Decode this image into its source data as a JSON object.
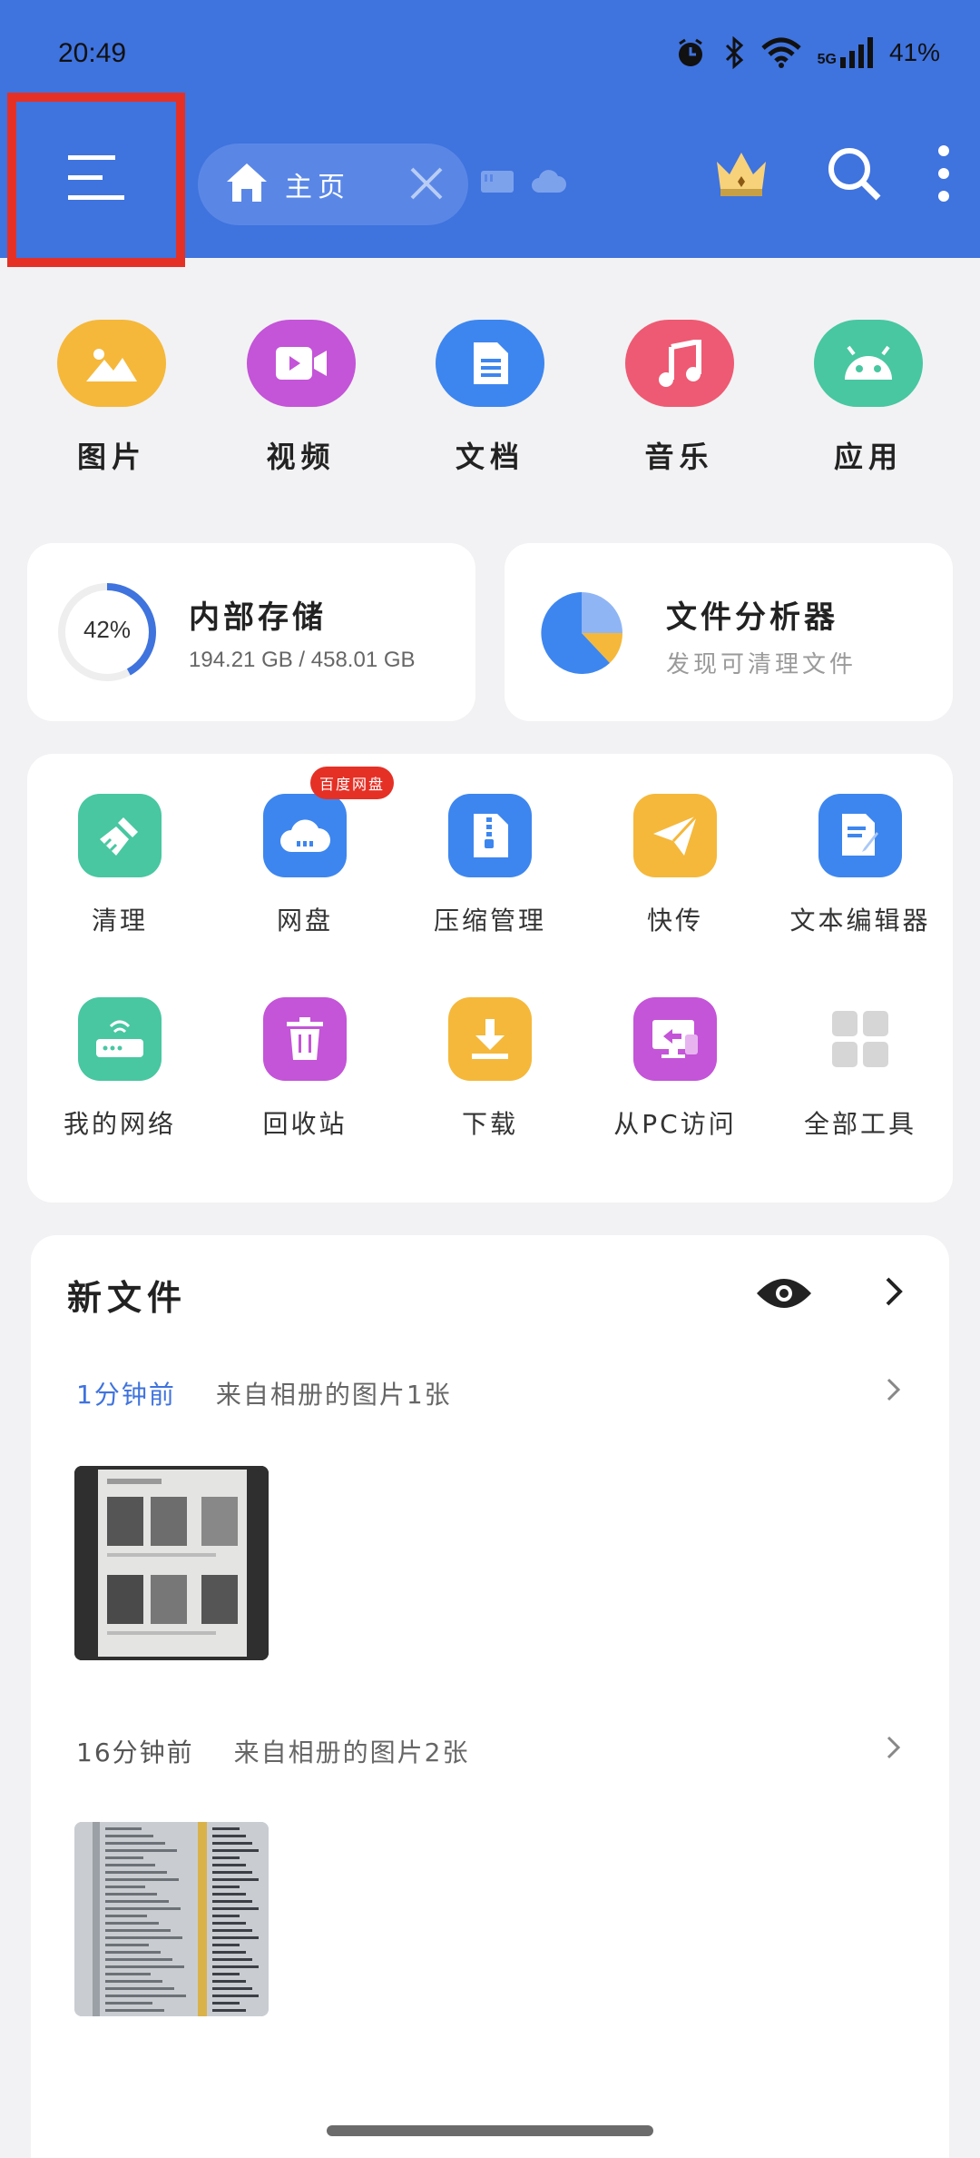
{
  "status_bar": {
    "time": "20:49",
    "network": "5G",
    "battery": "41%"
  },
  "header": {
    "tab_label": "主页",
    "colors": {
      "header_bg": "#3f73de",
      "highlight_border": "#e53026"
    }
  },
  "categories": [
    {
      "label": "图片",
      "icon": "image-icon",
      "color": "#f5b83a"
    },
    {
      "label": "视频",
      "icon": "video-icon",
      "color": "#c454d8"
    },
    {
      "label": "文档",
      "icon": "document-icon",
      "color": "#3d86ef"
    },
    {
      "label": "音乐",
      "icon": "music-icon",
      "color": "#ee5a73"
    },
    {
      "label": "应用",
      "icon": "android-icon",
      "color": "#48c7a1"
    }
  ],
  "storage": {
    "title": "内部存储",
    "percent_text": "42%",
    "percent_value": 0.42,
    "usage": "194.21 GB / 458.01 GB"
  },
  "analyzer": {
    "title": "文件分析器",
    "subtitle": "发现可清理文件"
  },
  "tools": [
    {
      "label": "清理",
      "icon": "broom-icon",
      "color": "#48c7a1"
    },
    {
      "label": "网盘",
      "icon": "cloud-drive-icon",
      "color": "#3d86ef",
      "badge": "百度网盘"
    },
    {
      "label": "压缩管理",
      "icon": "zip-icon",
      "color": "#3d86ef"
    },
    {
      "label": "快传",
      "icon": "paper-plane-icon",
      "color": "#f5b83a"
    },
    {
      "label": "文本编辑器",
      "icon": "text-editor-icon",
      "color": "#3d86ef"
    },
    {
      "label": "我的网络",
      "icon": "router-icon",
      "color": "#48c7a1"
    },
    {
      "label": "回收站",
      "icon": "trash-icon",
      "color": "#c454d8"
    },
    {
      "label": "下载",
      "icon": "download-icon",
      "color": "#f5b83a"
    },
    {
      "label": "从PC访问",
      "icon": "pc-access-icon",
      "color": "#c454d8"
    },
    {
      "label": "全部工具",
      "icon": "grid-icon",
      "color": "#d6d6d6"
    }
  ],
  "new_files": {
    "title": "新文件",
    "groups": [
      {
        "time": "1分钟前",
        "desc": "来自相册的图片1张"
      },
      {
        "time": "16分钟前",
        "desc": "来自相册的图片2张"
      }
    ]
  }
}
